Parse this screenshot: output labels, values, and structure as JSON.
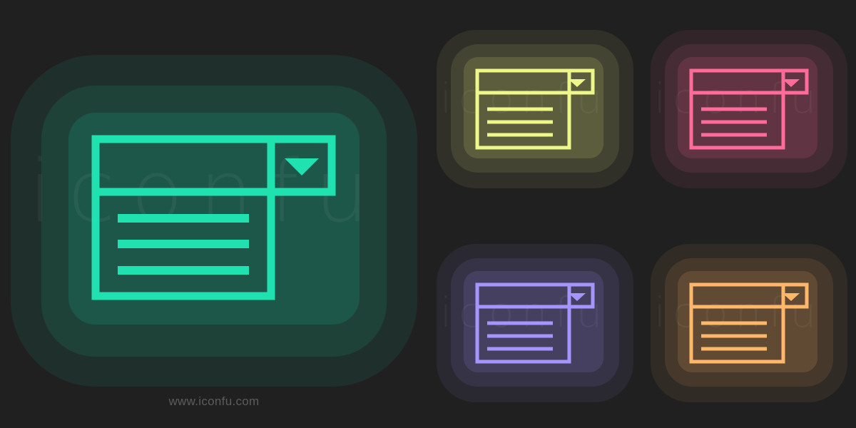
{
  "footer_text": "www.iconfu.com",
  "watermark_text": "iconfu",
  "icon_name": "dropdown-list-icon",
  "variants": [
    {
      "name": "large-green",
      "color": "#1fe2b0"
    },
    {
      "name": "small-yellow",
      "color": "#eef88a"
    },
    {
      "name": "small-pink",
      "color": "#ff6b9a"
    },
    {
      "name": "small-purple",
      "color": "#a695ff"
    },
    {
      "name": "small-orange",
      "color": "#ffb86a"
    }
  ]
}
